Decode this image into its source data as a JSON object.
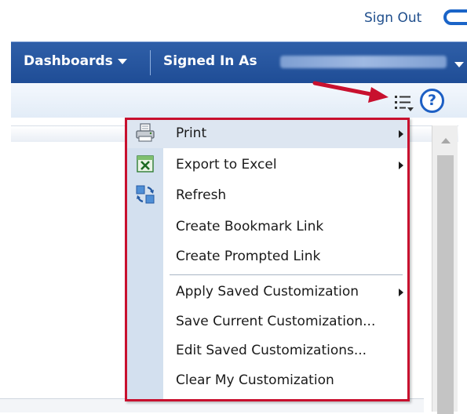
{
  "header": {
    "sign_out": "Sign Out"
  },
  "nav": {
    "dashboards": "Dashboards",
    "signed_in_as": "Signed In As"
  },
  "colors": {
    "nav_blue": "#1f4d96",
    "menu_border": "#c8102e",
    "arrow_red": "#c8102e"
  },
  "toolbar": {
    "page_options_icon": "page-options-icon",
    "help_symbol": "?"
  },
  "menu": {
    "items": [
      {
        "label": "Print",
        "icon": "printer-icon",
        "submenu": true,
        "highlighted": true
      },
      {
        "label": "Export to Excel",
        "icon": "excel-icon",
        "submenu": true
      },
      {
        "label": "Refresh",
        "icon": "refresh-icon",
        "submenu": false
      },
      {
        "label": "Create Bookmark Link",
        "submenu": false
      },
      {
        "label": "Create Prompted Link",
        "submenu": false
      },
      {
        "label": "Apply Saved Customization",
        "submenu": true
      },
      {
        "label": "Save Current Customization...",
        "submenu": false
      },
      {
        "label": "Edit Saved Customizations...",
        "submenu": false
      },
      {
        "label": "Clear My Customization",
        "submenu": false
      }
    ]
  }
}
